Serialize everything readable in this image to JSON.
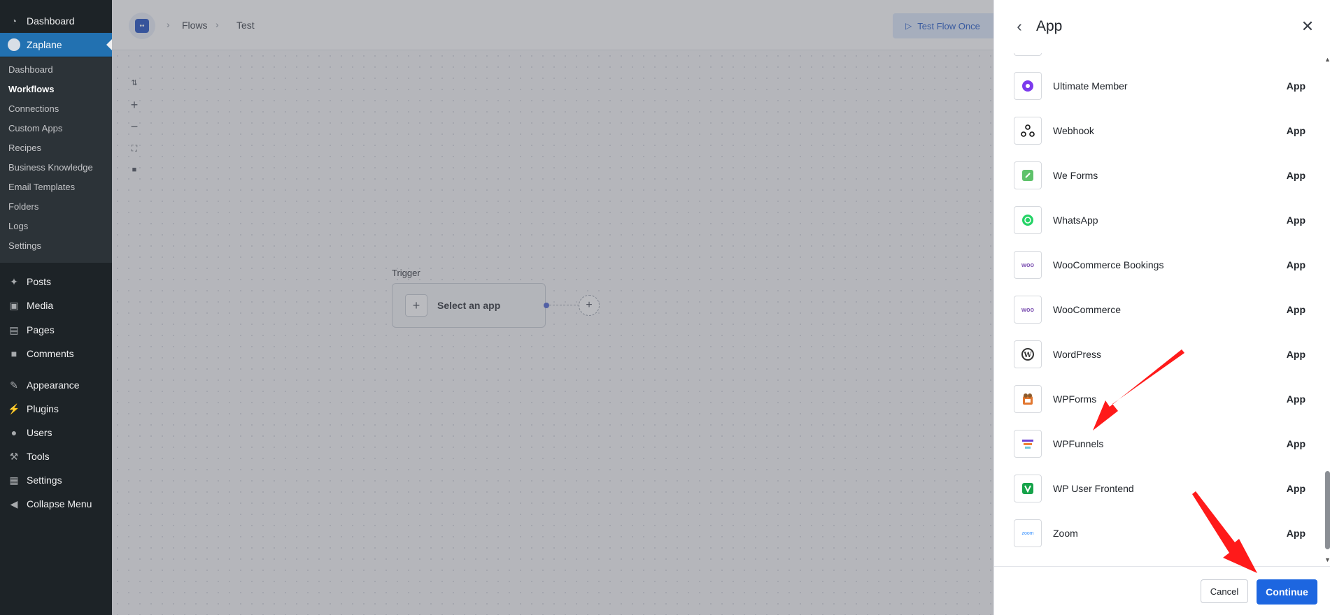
{
  "admin_menu": {
    "top_items": [
      {
        "label": "Dashboard",
        "icon": "dashboard-icon"
      },
      {
        "label": "Zaplane",
        "icon": "zaplane-icon"
      }
    ],
    "submenu": [
      "Dashboard",
      "Workflows",
      "Connections",
      "Custom Apps",
      "Recipes",
      "Business Knowledge",
      "Email Templates",
      "Folders",
      "Logs",
      "Settings"
    ],
    "lower_items": [
      {
        "label": "Posts",
        "icon": "pin-icon"
      },
      {
        "label": "Media",
        "icon": "media-icon"
      },
      {
        "label": "Pages",
        "icon": "pages-icon"
      },
      {
        "label": "Comments",
        "icon": "comment-icon"
      },
      {
        "label": "Appearance",
        "icon": "brush-icon"
      },
      {
        "label": "Plugins",
        "icon": "plugin-icon"
      },
      {
        "label": "Users",
        "icon": "user-icon"
      },
      {
        "label": "Tools",
        "icon": "wrench-icon"
      },
      {
        "label": "Settings",
        "icon": "settings-icon"
      },
      {
        "label": "Collapse Menu",
        "icon": "collapse-icon"
      }
    ]
  },
  "topbar": {
    "breadcrumb": [
      "Flows",
      "Test"
    ],
    "test_button": "Test Flow Once"
  },
  "canvas": {
    "trigger_label": "Trigger",
    "trigger_card": "Select an app"
  },
  "drawer": {
    "title": "App",
    "apps": [
      {
        "name": "Ultimate Member",
        "type": "App",
        "logo": "ultimate-member-logo"
      },
      {
        "name": "Webhook",
        "type": "App",
        "logo": "webhook-logo"
      },
      {
        "name": "We Forms",
        "type": "App",
        "logo": "weforms-logo"
      },
      {
        "name": "WhatsApp",
        "type": "App",
        "logo": "whatsapp-logo"
      },
      {
        "name": "WooCommerce Bookings",
        "type": "App",
        "logo": "woo-logo"
      },
      {
        "name": "WooCommerce",
        "type": "App",
        "logo": "woo-logo"
      },
      {
        "name": "WordPress",
        "type": "App",
        "logo": "wordpress-logo"
      },
      {
        "name": "WPForms",
        "type": "App",
        "logo": "wpforms-logo"
      },
      {
        "name": "WPFunnels",
        "type": "App",
        "logo": "wpfunnels-logo"
      },
      {
        "name": "WP User Frontend",
        "type": "App",
        "logo": "wpuf-logo"
      },
      {
        "name": "Zoom",
        "type": "App",
        "logo": "zoom-logo"
      }
    ],
    "logo_text": {
      "woo": "woo",
      "zoom": "zoom"
    },
    "cancel": "Cancel",
    "continue": "Continue"
  },
  "colors": {
    "admin_bg": "#1d2327",
    "admin_current": "#2271b1",
    "primary_button": "#1d66e0",
    "annotation_arrow": "#ff1a1a"
  }
}
